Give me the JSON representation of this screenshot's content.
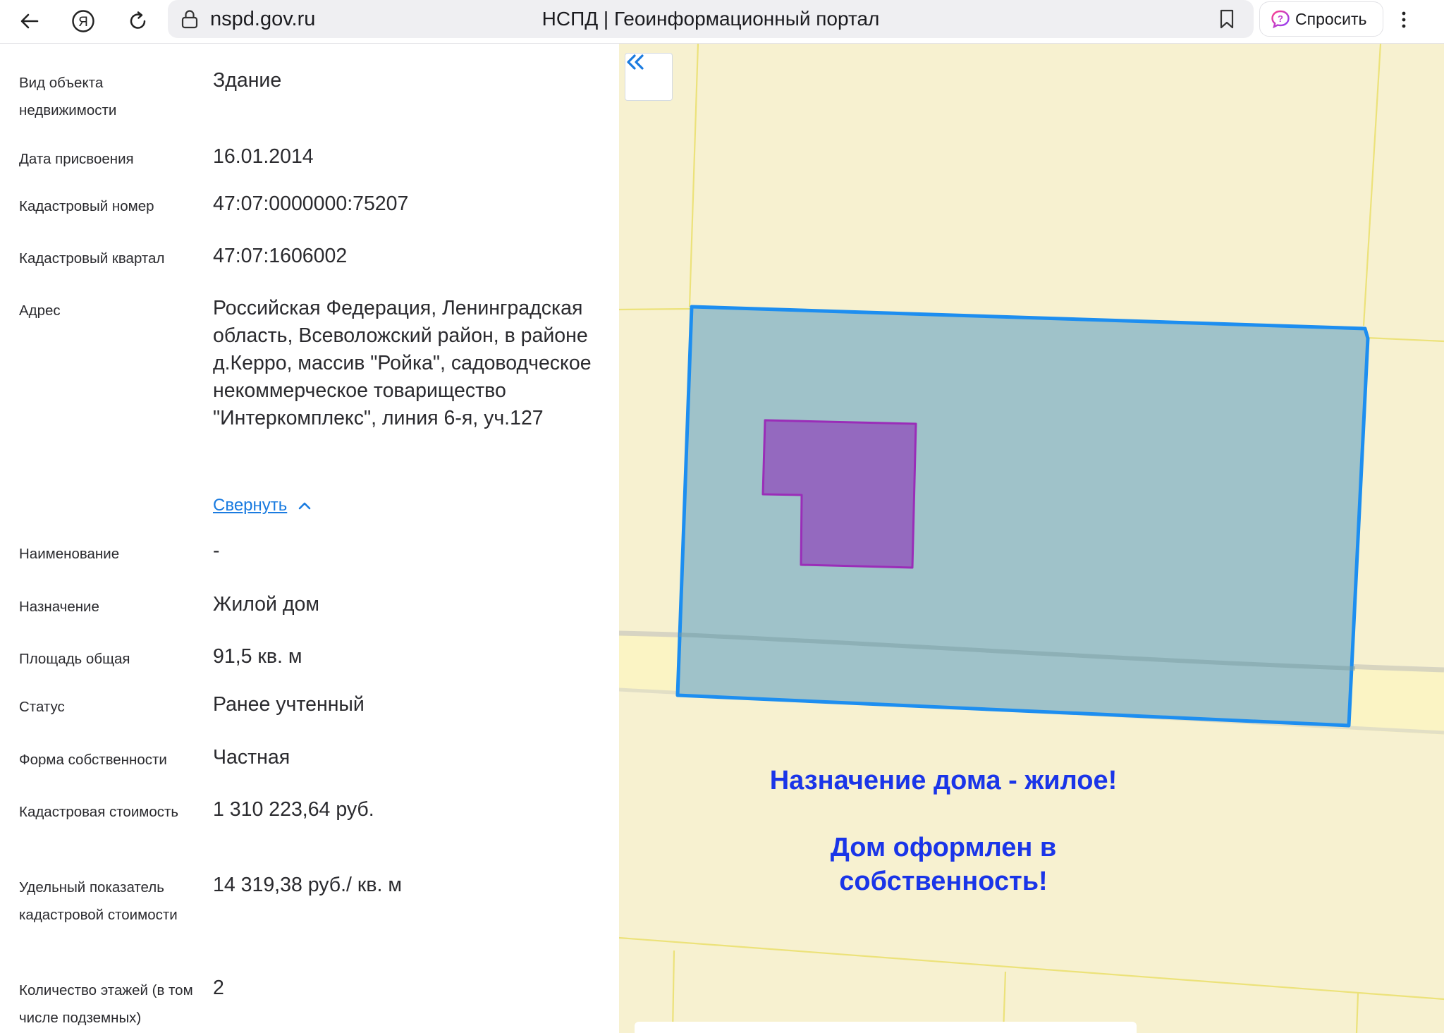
{
  "browser": {
    "url": "nspd.gov.ru",
    "title": "НСПД | Геоинформационный портал",
    "ask_label": "Спросить",
    "icons": [
      "back-arrow-icon",
      "yandex-logo-icon",
      "reload-icon",
      "lock-icon",
      "bookmark-icon",
      "ask-ai-icon",
      "more-vert-icon"
    ]
  },
  "properties": [
    {
      "label": "Вид объекта недвижимости",
      "value": "Здание"
    },
    {
      "label": "Дата присвоения",
      "value": "16.01.2014"
    },
    {
      "label": "Кадастровый номер",
      "value": "47:07:0000000:75207"
    },
    {
      "label": "Кадастровый квартал",
      "value": "47:07:1606002"
    },
    {
      "label": "Адрес",
      "value": "Российская Федерация, Ленинградская область, Всеволожский район, в районе д.Керро, массив \"Ройка\", садоводческое некоммерческое товарищество \"Интеркомплекс\", линия 6-я, уч.127"
    },
    {
      "label": "Наименование",
      "value": "-"
    },
    {
      "label": "Назначение",
      "value": "Жилой дом"
    },
    {
      "label": "Площадь общая",
      "value": "91,5 кв. м"
    },
    {
      "label": "Статус",
      "value": "Ранее учтенный"
    },
    {
      "label": "Форма собственности",
      "value": "Частная"
    },
    {
      "label": "Кадастровая стоимость",
      "value": "1 310 223,64 руб."
    },
    {
      "label": "Удельный показатель кадастровой стоимости",
      "value": "14 319,38 руб./ кв. м"
    },
    {
      "label": "Количество этажей (в том числе подземных)",
      "value": "2"
    }
  ],
  "collapse_label": "Свернуть",
  "map": {
    "note_line1": "Назначение дома - жилое!",
    "note_line2": "Дом оформлен в",
    "note_line3": "собственность!",
    "colors": {
      "background": "#f7f1d0",
      "parcel_fill": "#9fc2c9",
      "parcel_stroke": "#1d8ef0",
      "building_fill": "#9469bf",
      "building_stroke": "#9a2db8",
      "note_text": "#1a35e8"
    }
  }
}
